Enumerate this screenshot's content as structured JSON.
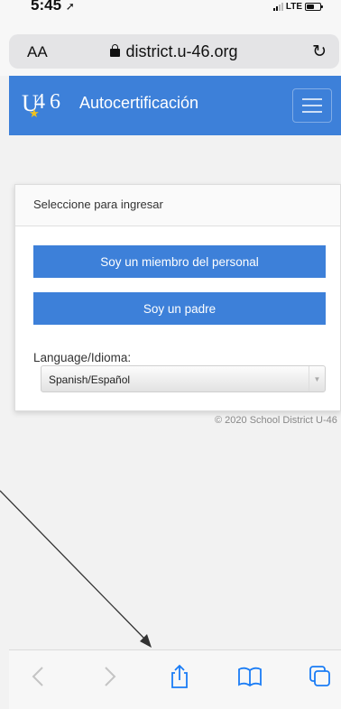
{
  "status_bar": {
    "time": "5:45",
    "carrier": "LTE"
  },
  "browser": {
    "text_size_label": "AA",
    "url": "district.u-46.org"
  },
  "header": {
    "logo_u": "U",
    "logo_4": "4",
    "logo_6": "6",
    "title": "Autocertificación"
  },
  "card": {
    "header": "Seleccione para ingresar",
    "staff_button": "Soy un miembro del personal",
    "parent_button": "Soy un padre",
    "language_label": "Language/Idioma:",
    "language_selected": "Spanish/Español"
  },
  "footer": {
    "copyright": "© 2020 School District U-46"
  },
  "icons": {
    "lock": "lock-icon",
    "reload": "reload-icon",
    "menu": "hamburger-icon",
    "back": "chevron-left-icon",
    "forward": "chevron-right-icon",
    "share": "share-icon",
    "bookmarks": "book-icon",
    "tabs": "tabs-icon"
  },
  "colors": {
    "brand": "#3d80d9",
    "logo_accent": "#f3c21b"
  }
}
